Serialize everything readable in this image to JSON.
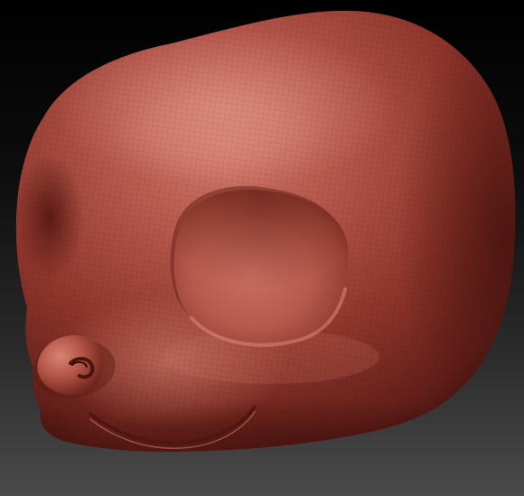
{
  "scene": {
    "subject": "sculpted-creature-head",
    "colors": {
      "background_top": "#000000",
      "background_bottom": "#4a4a4a",
      "clay_base": "#9e4136",
      "clay_light": "#cf7466",
      "clay_dark": "#4f1510",
      "clay_highlight": "#e49a8c"
    }
  }
}
